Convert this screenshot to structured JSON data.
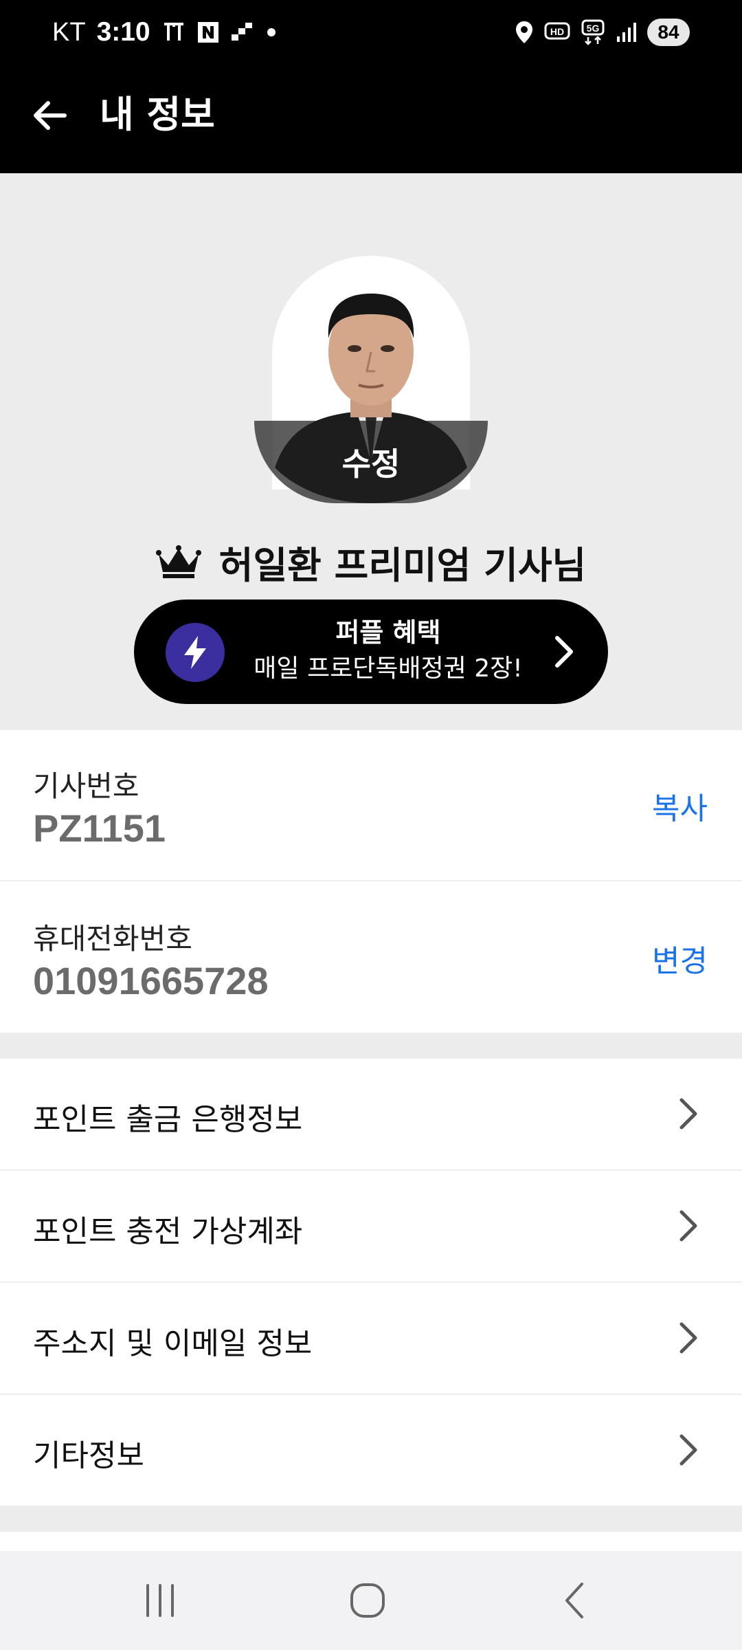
{
  "status_bar": {
    "carrier": "KT",
    "time": "3:10",
    "battery": "84",
    "icons": [
      "t-icon",
      "naver-icon",
      "stairs-icon",
      "dot-icon",
      "location-icon",
      "hd-icon",
      "5g-icon",
      "signal-icon"
    ]
  },
  "app_bar": {
    "title": "내 정보",
    "back_icon": "arrow-left-icon"
  },
  "profile": {
    "edit_label": "수정",
    "crown_icon": "crown-icon",
    "name": "허일환 프리미엄 기사님",
    "benefit": {
      "title": "퍼플 혜택",
      "subtitle": "매일 프로단독배정권 2장!",
      "icon": "lightning-icon",
      "accent": "#3b2fa0"
    }
  },
  "info": [
    {
      "label": "기사번호",
      "value": "PZ1151",
      "action": "복사"
    },
    {
      "label": "휴대전화번호",
      "value": "01091665728",
      "action": "변경"
    }
  ],
  "menu": [
    {
      "label": "포인트 출금 은행정보"
    },
    {
      "label": "포인트 충전 가상계좌"
    },
    {
      "label": "주소지 및 이메일 정보"
    },
    {
      "label": "기타정보"
    }
  ],
  "colors": {
    "action_blue": "#1a73e8",
    "header_black": "#000000",
    "section_gray": "#ececec"
  },
  "nav_bar": {
    "icons": [
      "recent-apps-icon",
      "home-icon",
      "back-icon"
    ]
  }
}
